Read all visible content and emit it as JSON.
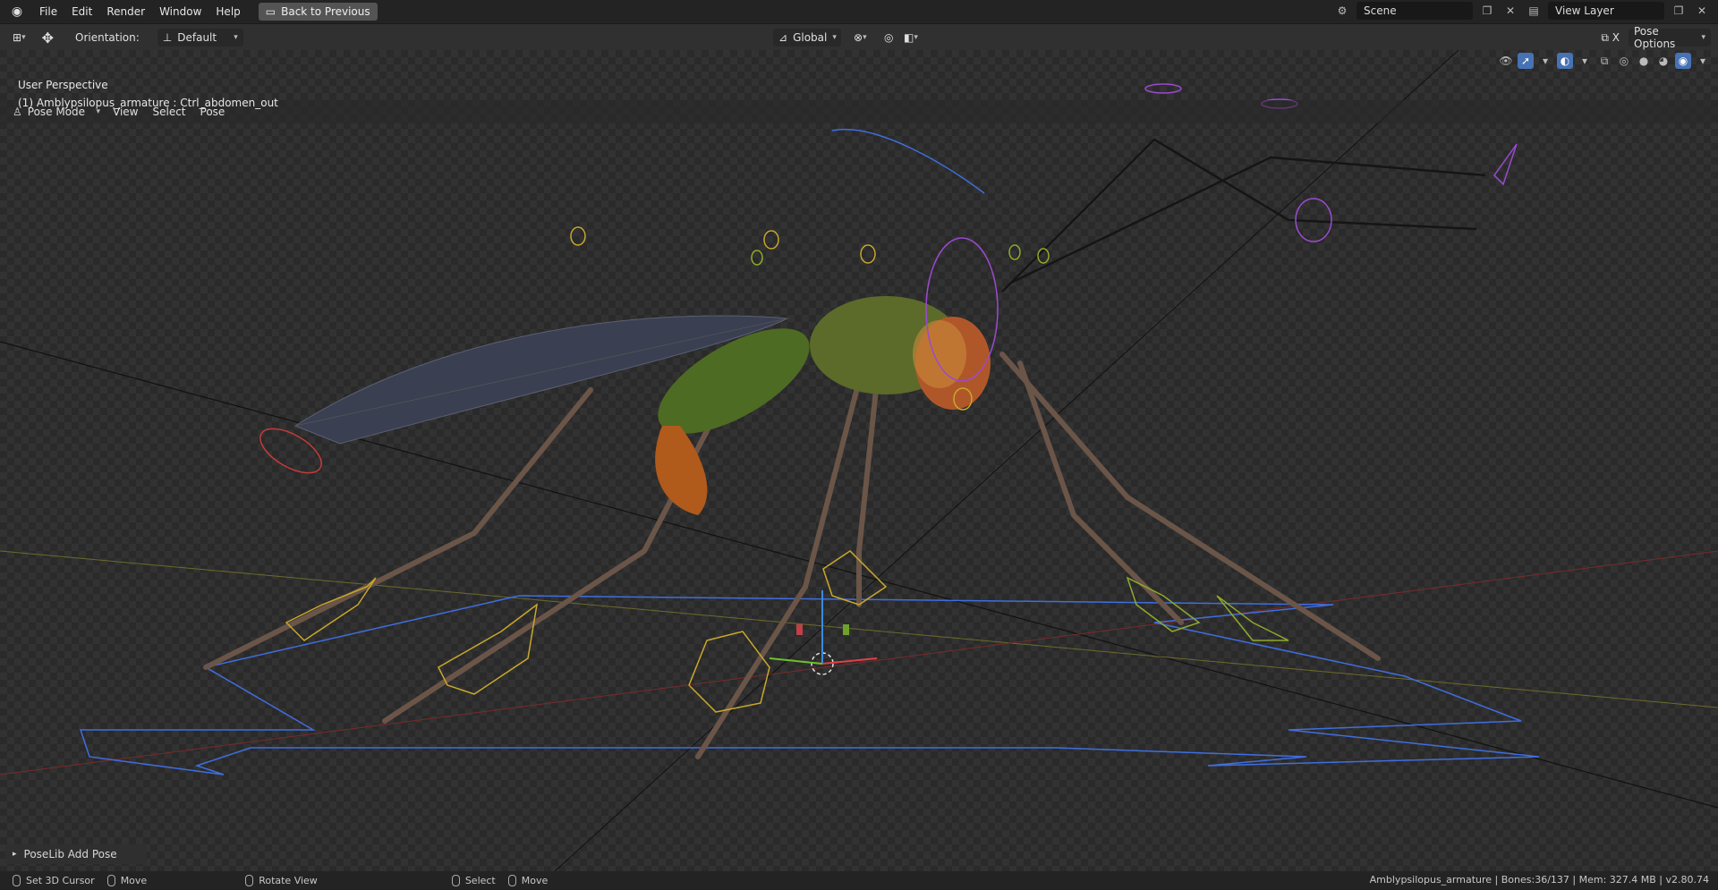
{
  "topbar": {
    "menus": [
      "File",
      "Edit",
      "Render",
      "Window",
      "Help"
    ],
    "back_button": "Back to Previous",
    "scene": "Scene",
    "view_layer": "View Layer"
  },
  "header": {
    "orientation_label": "Orientation:",
    "orientation_value": "Default",
    "transform_space": "Global",
    "pose_options": "Pose Options"
  },
  "viewport_header": {
    "mode": "Pose Mode",
    "menus": [
      "View",
      "Select",
      "Pose"
    ]
  },
  "viewport": {
    "perspective": "User Perspective",
    "active_object": "(1) Amblypsilopus_armature : Ctrl_abdomen_out"
  },
  "last_operator": "PoseLib Add Pose",
  "statusbar": {
    "items": [
      "Set 3D Cursor",
      "Move",
      "Rotate View",
      "Select",
      "Move"
    ],
    "info": "Amblypsilopus_armature | Bones:36/137 | Mem: 327.4 MB | v2.80.74"
  },
  "colors": {
    "accent": "#4772b3",
    "panel": "#303030",
    "topbar": "#232323"
  }
}
